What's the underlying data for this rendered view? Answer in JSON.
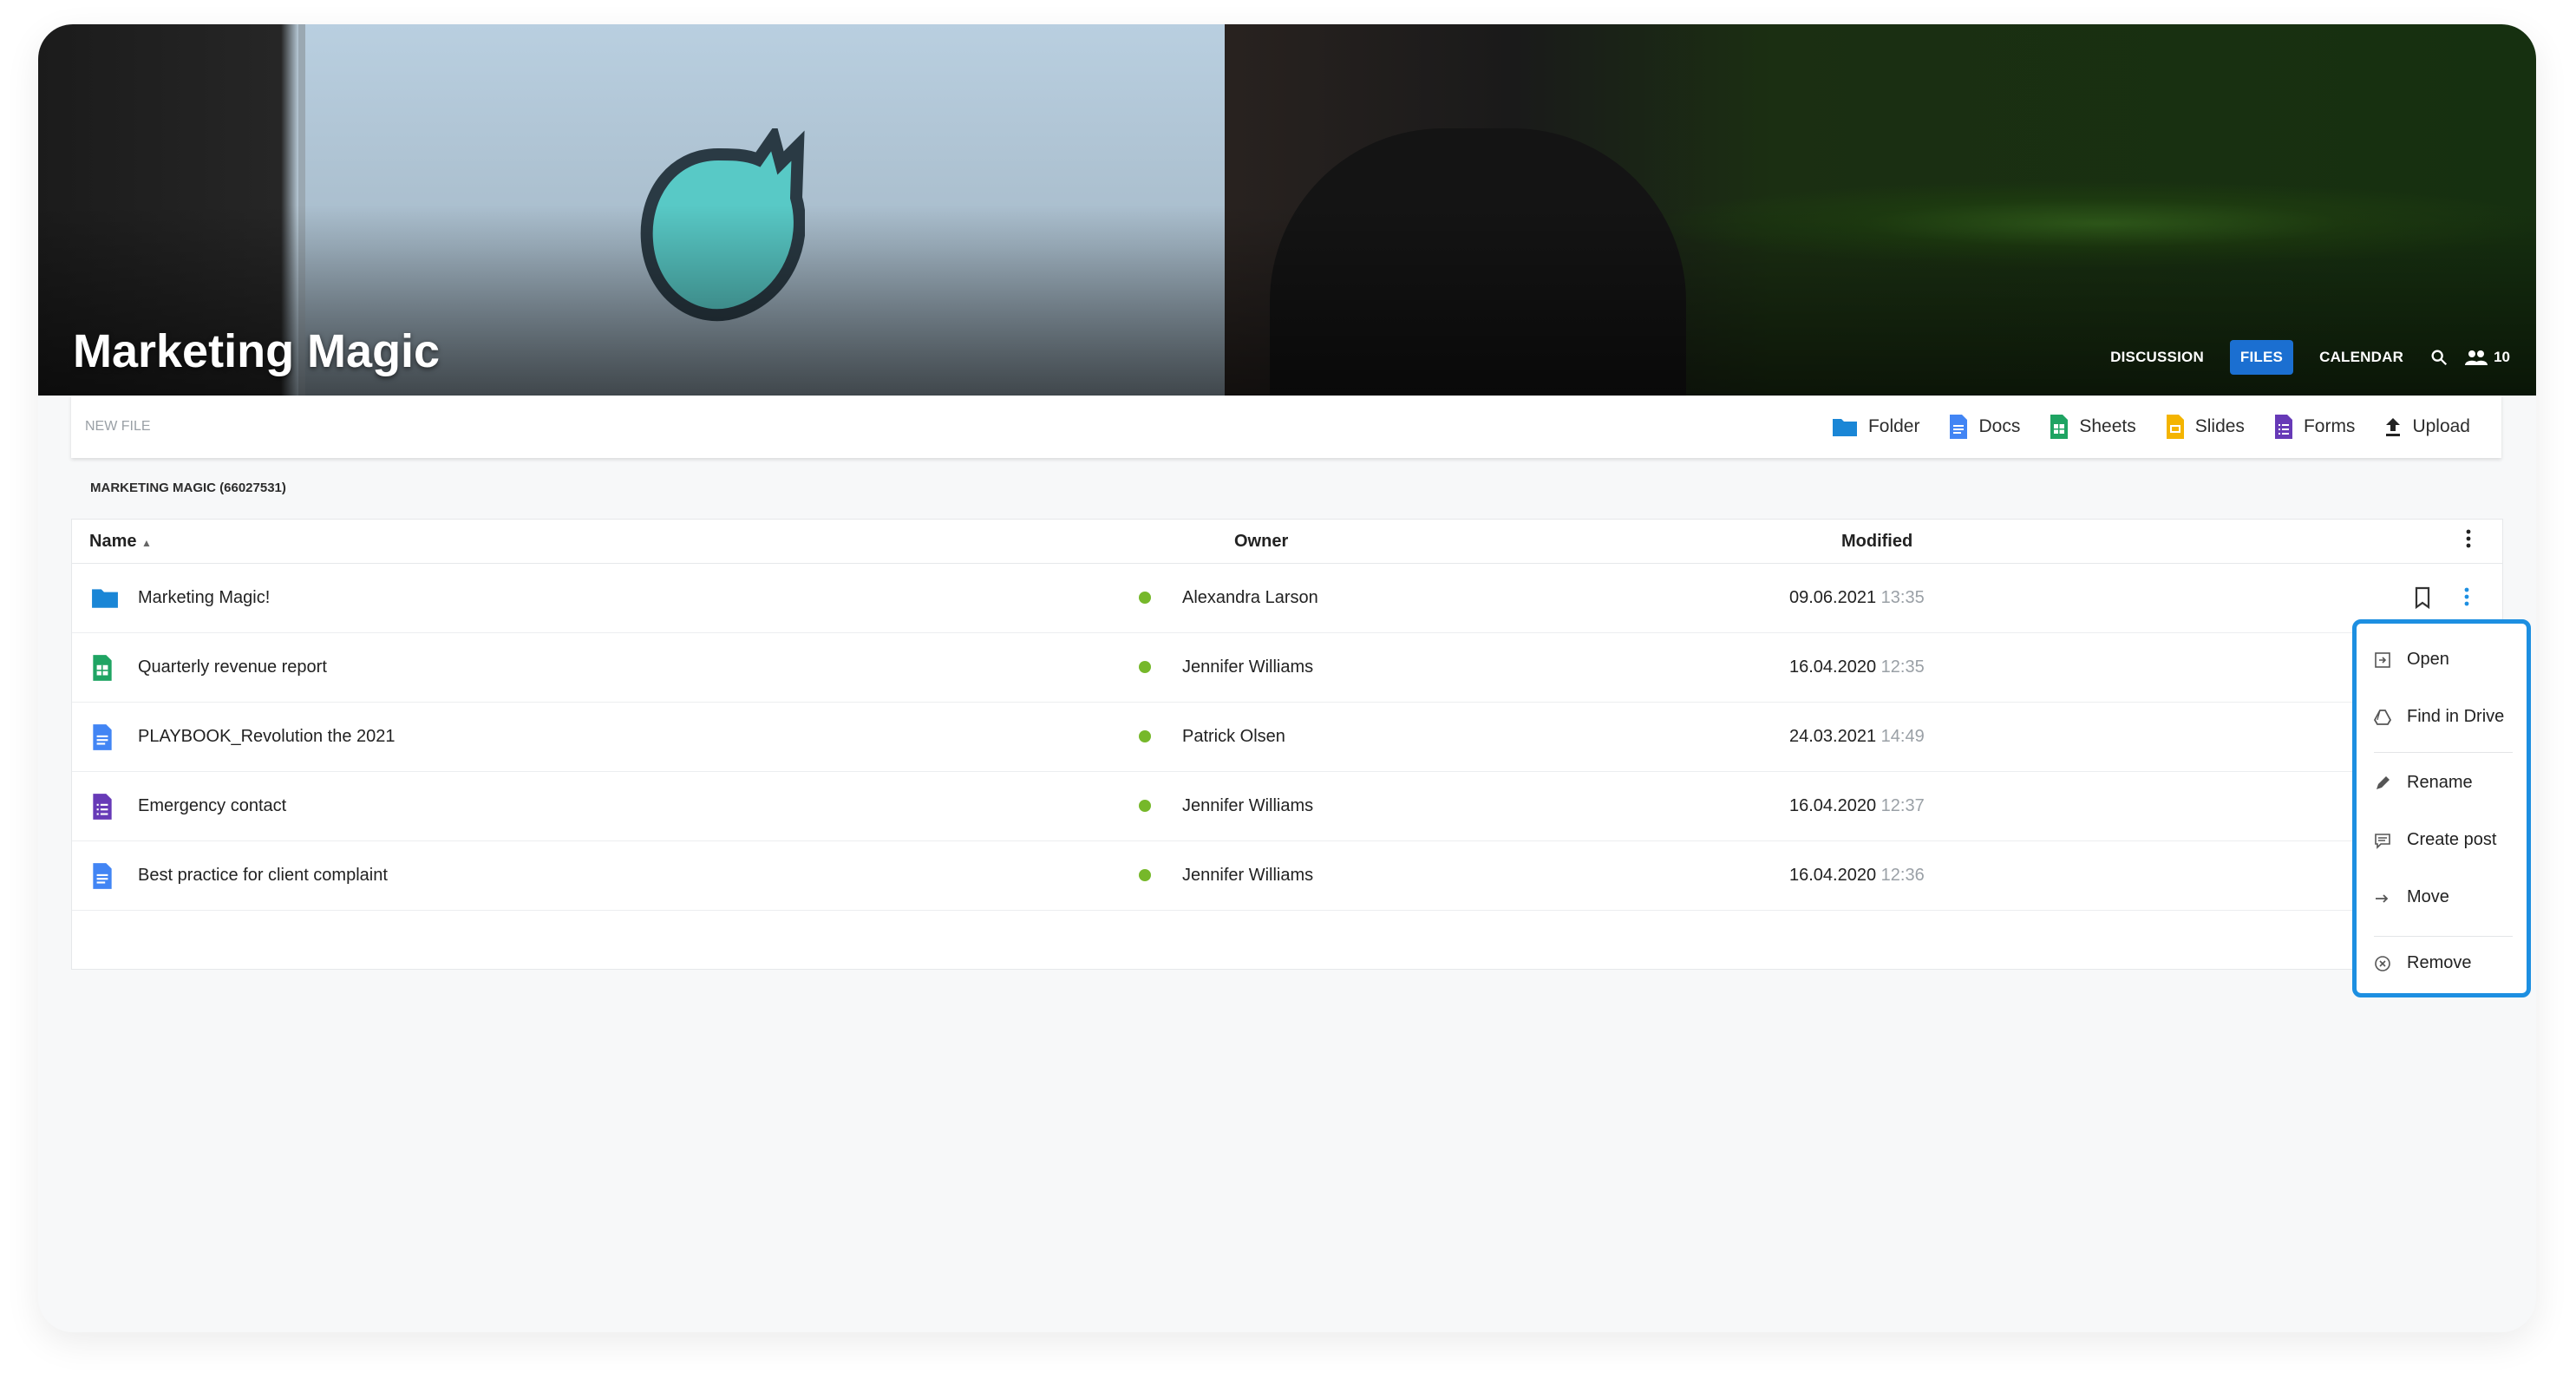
{
  "group": {
    "title": "Marketing Magic"
  },
  "nav": {
    "discussion": "DISCUSSION",
    "files": "FILES",
    "calendar": "CALENDAR",
    "members_count": "10"
  },
  "toolbar": {
    "new_file": "NEW FILE",
    "folder": "Folder",
    "docs": "Docs",
    "sheets": "Sheets",
    "slides": "Slides",
    "forms": "Forms",
    "upload": "Upload"
  },
  "breadcrumb": "MARKETING MAGIC (66027531)",
  "table": {
    "headers": {
      "name": "Name",
      "owner": "Owner",
      "modified": "Modified"
    },
    "rows": [
      {
        "name": "Marketing Magic!",
        "type": "folder",
        "owner": "Alexandra Larson",
        "date": "09.06.2021",
        "time": "13:35"
      },
      {
        "name": "Quarterly revenue report",
        "type": "sheets",
        "owner": "Jennifer Williams",
        "date": "16.04.2020",
        "time": "12:35"
      },
      {
        "name": "PLAYBOOK_Revolution the 2021",
        "type": "docs",
        "owner": "Patrick Olsen",
        "date": "24.03.2021",
        "time": "14:49"
      },
      {
        "name": "Emergency contact",
        "type": "forms",
        "owner": "Jennifer Williams",
        "date": "16.04.2020",
        "time": "12:37"
      },
      {
        "name": "Best practice for client complaint",
        "type": "docs",
        "owner": "Jennifer Williams",
        "date": "16.04.2020",
        "time": "12:36"
      }
    ]
  },
  "context_menu": {
    "open": "Open",
    "find_in_drive": "Find in Drive",
    "rename": "Rename",
    "create_post": "Create post",
    "move": "Move",
    "remove": "Remove"
  },
  "colors": {
    "accent": "#1b6fd1",
    "menu_border": "#1d8fe1",
    "online": "#76b82a",
    "sheets": "#1fa463",
    "docs": "#4285f4",
    "slides": "#f4b400",
    "forms": "#673ab7",
    "folder": "#1a86d6"
  }
}
